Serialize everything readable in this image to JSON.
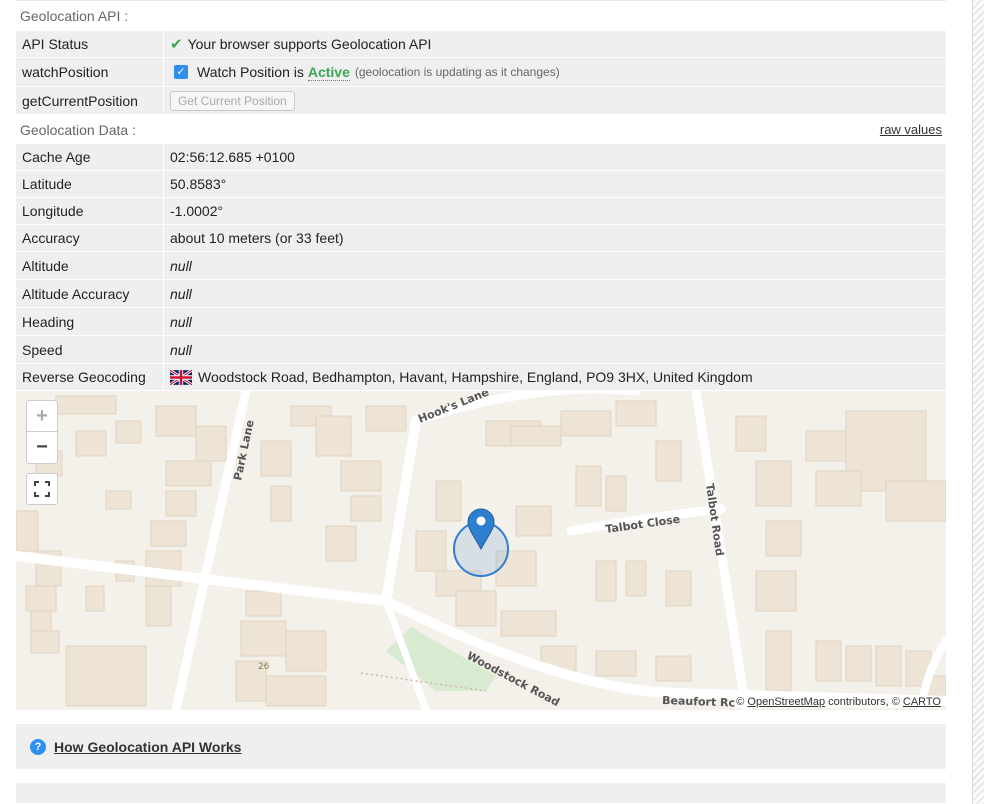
{
  "geolocation_api": {
    "heading": "Geolocation API :",
    "rows": {
      "api_status": {
        "label": "API Status",
        "value": "Your browser supports Geolocation API"
      },
      "watch_position": {
        "label": "watchPosition",
        "prefix": "Watch Position is",
        "state": "Active",
        "note": "(geolocation is updating as it changes)"
      },
      "get_current": {
        "label": "getCurrentPosition",
        "button": "Get Current Position"
      }
    }
  },
  "geolocation_data": {
    "heading": "Geolocation Data :",
    "raw_values": "raw values",
    "rows": [
      {
        "label": "Cache Age",
        "value": "02:56:12.685 +0100"
      },
      {
        "label": "Latitude",
        "value": "50.8583°"
      },
      {
        "label": "Longitude",
        "value": "-1.0002°"
      },
      {
        "label": "Accuracy",
        "value": "about 10 meters (or 33 feet)"
      },
      {
        "label": "Altitude",
        "value": "null"
      },
      {
        "label": "Altitude Accuracy",
        "value": "null"
      },
      {
        "label": "Heading",
        "value": "null"
      },
      {
        "label": "Speed",
        "value": "null"
      },
      {
        "label": "Reverse Geocoding",
        "value": "Woodstock Road, Bedhampton, Havant, Hampshire, England, PO9 3HX, United Kingdom"
      }
    ]
  },
  "map": {
    "zoom_in": "+",
    "zoom_out": "−",
    "streets": {
      "hooks_lane": "Hook's Lane",
      "park_lane": "Park Lane",
      "talbot_close": "Talbot Close",
      "talbot_road": "Talbot Road",
      "woodstock_road": "Woodstock Road",
      "beaufort_rd": "Beaufort Rc",
      "house_number": "26"
    },
    "attribution": {
      "copy1": "©",
      "osm": "OpenStreetMap",
      "middle": "contributors, ©",
      "carto": "CARTO"
    },
    "colors": {
      "land": "#f4f0ea",
      "building": "#eee4d6",
      "park": "#d8ebd0",
      "marker": "#2f7fd0"
    }
  },
  "howto": {
    "icon": "?",
    "link": "How Geolocation API Works"
  }
}
